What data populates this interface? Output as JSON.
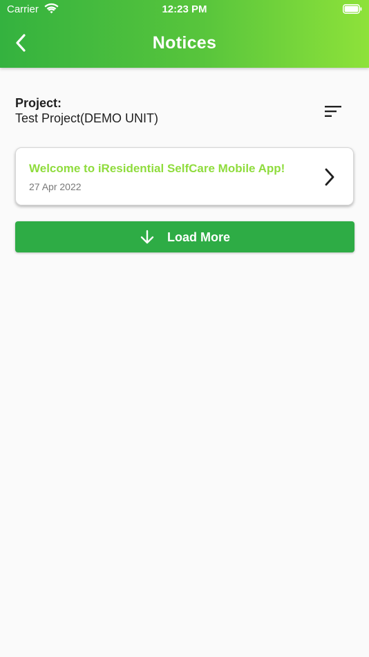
{
  "status_bar": {
    "carrier": "Carrier",
    "time": "12:23 PM"
  },
  "header": {
    "title": "Notices",
    "back_icon": "chevron-left-icon",
    "gradient_start": "#34b23f",
    "gradient_end": "#8ee23a"
  },
  "project": {
    "label": "Project:",
    "value": "Test Project(DEMO UNIT)",
    "sort_icon": "sort-icon"
  },
  "notices": [
    {
      "title": "Welcome to iResidential SelfCare Mobile App!",
      "date": "27 Apr 2022",
      "title_color": "#8fdc3d"
    }
  ],
  "load_more": {
    "label": "Load More",
    "icon": "arrow-down-icon",
    "color": "#2eac45"
  }
}
